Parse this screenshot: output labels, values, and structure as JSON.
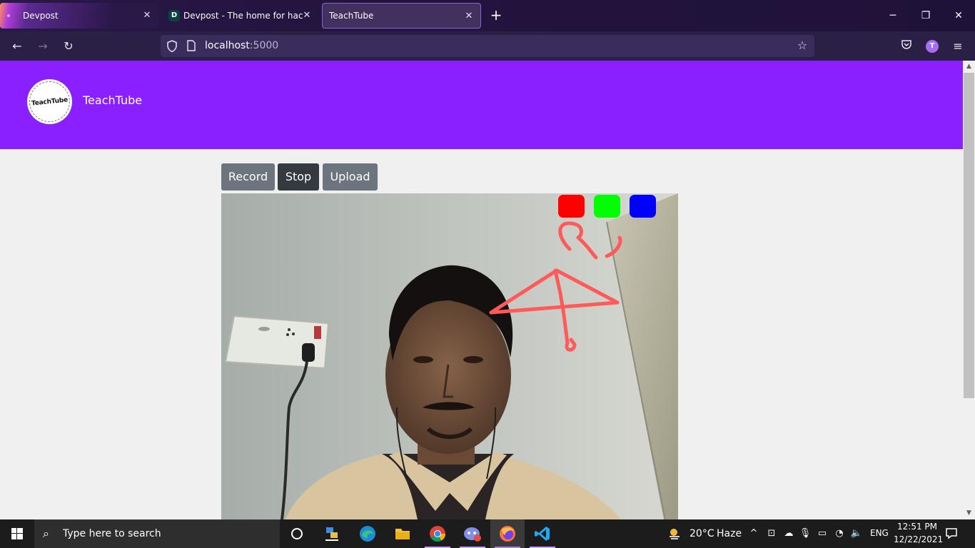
{
  "browser": {
    "tabs": [
      {
        "label": "Devpost"
      },
      {
        "label": "Devpost - The home for hackathons",
        "favicon": "D"
      },
      {
        "label": "TeachTube"
      }
    ],
    "url_host": "localhost",
    "url_port": ":5000",
    "profile_initial": "T"
  },
  "header": {
    "logo_text": "TeachTube",
    "brand": "TeachTube"
  },
  "controls": {
    "record_label": "Record",
    "stop_label": "Stop",
    "upload_label": "Upload"
  },
  "palette": {
    "colors": {
      "red": "#ff0000",
      "green": "#00ff00",
      "blue": "#0000ff"
    },
    "stroke_color": "#ff5a5a"
  },
  "taskbar": {
    "search_placeholder": "Type here to search",
    "weather_temp": "20°C",
    "weather_desc": "Haze",
    "language": "ENG",
    "time": "12:51 PM",
    "date": "12/22/2021"
  },
  "theme": {
    "header_bg": "#8a20ff",
    "browser_dark": "#2a1f44"
  }
}
